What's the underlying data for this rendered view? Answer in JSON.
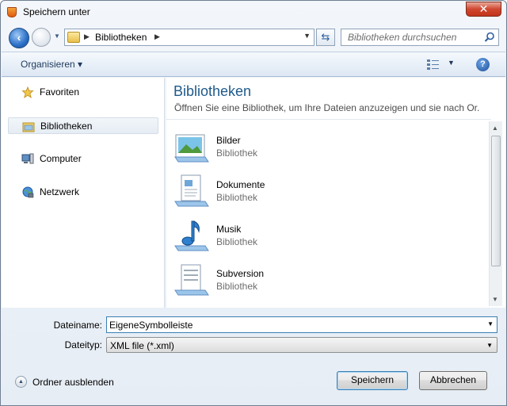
{
  "window": {
    "title": "Speichern unter",
    "close_glyph": "✕"
  },
  "nav": {
    "address_segment": "Bibliotheken",
    "search_placeholder": "Bibliotheken durchsuchen"
  },
  "toolbar": {
    "organize_label": "Organisieren ▾",
    "help_glyph": "?"
  },
  "sidebar": {
    "items": [
      {
        "label": "Favoriten",
        "icon": "star-icon"
      },
      {
        "label": "Bibliotheken",
        "icon": "libraries-icon",
        "selected": true
      },
      {
        "label": "Computer",
        "icon": "computer-icon"
      },
      {
        "label": "Netzwerk",
        "icon": "network-icon"
      }
    ]
  },
  "main": {
    "title": "Bibliotheken",
    "subtitle": "Öffnen Sie eine Bibliothek, um Ihre Dateien anzuzeigen und sie nach Or...",
    "libraries": [
      {
        "name": "Bilder",
        "type": "Bibliothek",
        "icon": "pictures-library-icon"
      },
      {
        "name": "Dokumente",
        "type": "Bibliothek",
        "icon": "documents-library-icon"
      },
      {
        "name": "Musik",
        "type": "Bibliothek",
        "icon": "music-library-icon"
      },
      {
        "name": "Subversion",
        "type": "Bibliothek",
        "icon": "subversion-library-icon"
      }
    ]
  },
  "form": {
    "filename_label": "Dateiname:",
    "filename_value": "EigeneSymbolleiste",
    "filetype_label": "Dateityp:",
    "filetype_value": "XML file (*.xml)"
  },
  "footer": {
    "hide_folders_label": "Ordner ausblenden",
    "save_label": "Speichern",
    "cancel_label": "Abbrechen"
  },
  "colors": {
    "accent": "#1e5a8a",
    "selection": "#e5ecf3",
    "close": "#c2341c"
  }
}
